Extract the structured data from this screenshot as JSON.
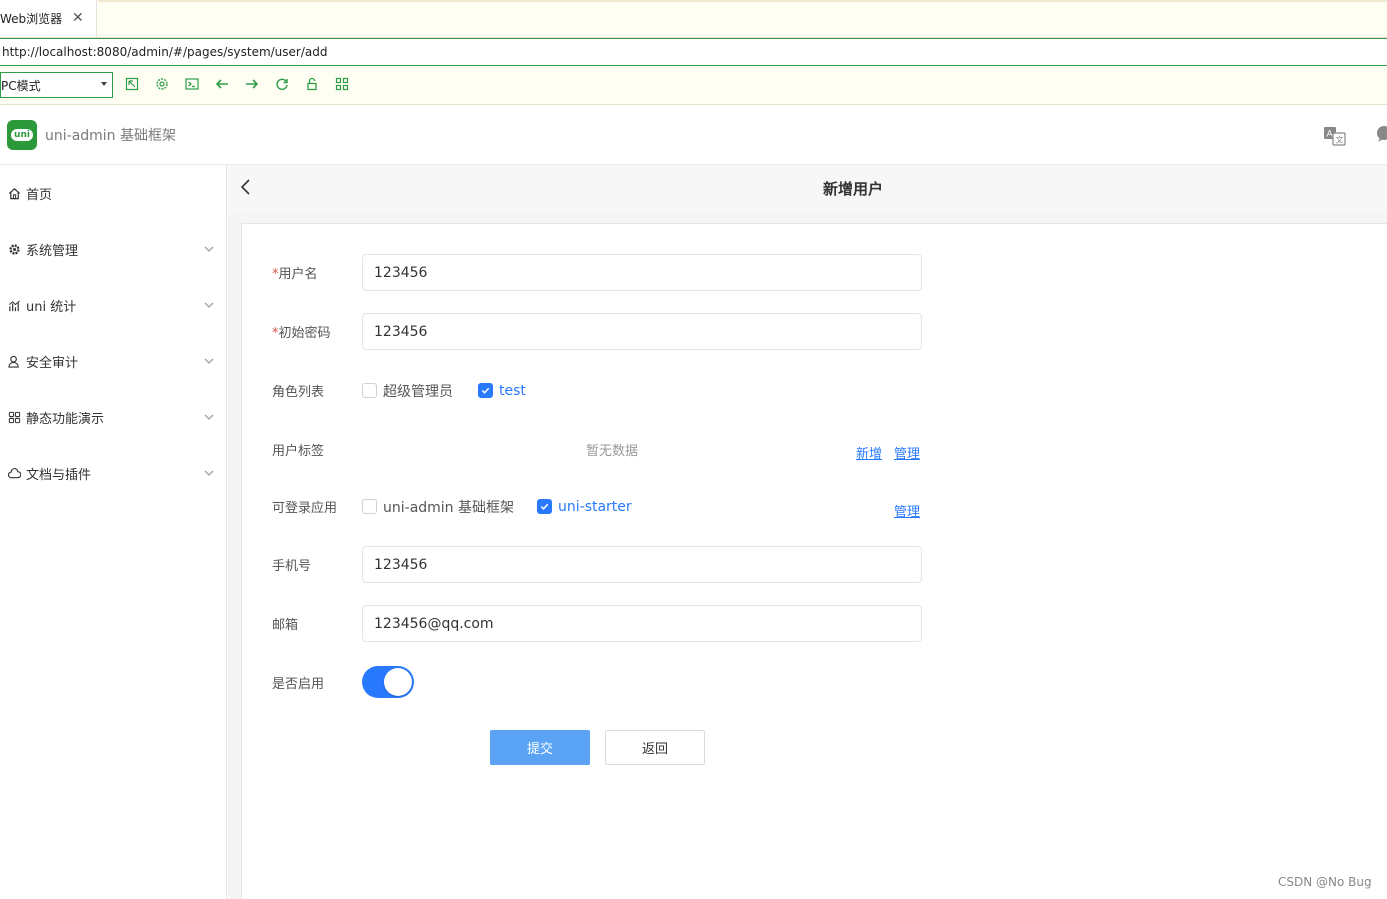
{
  "browser": {
    "tab_title": "Web浏览器",
    "tab_close": "✕",
    "url": "http://localhost:8080/admin/#/pages/system/user/add",
    "mode_select": "PC模式",
    "toolbar_icons": [
      "open-external-icon",
      "settings-icon",
      "console-icon",
      "back-arrow-icon",
      "forward-arrow-icon",
      "refresh-icon",
      "lock-icon",
      "qr-icon"
    ]
  },
  "header": {
    "logo_text": "uni",
    "app_title": "uni-admin 基础框架"
  },
  "sidebar": {
    "items": [
      {
        "label": "首页",
        "icon": "home-icon",
        "expandable": false
      },
      {
        "label": "系统管理",
        "icon": "gear-icon",
        "expandable": true
      },
      {
        "label": "uni 统计",
        "icon": "stats-icon",
        "expandable": true
      },
      {
        "label": "安全审计",
        "icon": "user-icon",
        "expandable": true
      },
      {
        "label": "静态功能演示",
        "icon": "grid-icon",
        "expandable": true
      },
      {
        "label": "文档与插件",
        "icon": "cloud-icon",
        "expandable": true
      }
    ]
  },
  "page": {
    "title": "新增用户"
  },
  "form": {
    "required_mark": "*",
    "username": {
      "label": "用户名",
      "value": "123456"
    },
    "password": {
      "label": "初始密码",
      "value": "123456"
    },
    "roles": {
      "label": "角色列表",
      "options": [
        {
          "label": "超级管理员",
          "checked": false
        },
        {
          "label": "test",
          "checked": true
        }
      ]
    },
    "tags": {
      "label": "用户标签",
      "empty": "暂无数据",
      "add_link": "新增",
      "manage_link": "管理"
    },
    "apps": {
      "label": "可登录应用",
      "options": [
        {
          "label": "uni-admin 基础框架",
          "checked": false
        },
        {
          "label": "uni-starter",
          "checked": true
        }
      ],
      "manage_link": "管理"
    },
    "mobile": {
      "label": "手机号",
      "value": "123456"
    },
    "email": {
      "label": "邮箱",
      "value": "123456@qq.com"
    },
    "enabled": {
      "label": "是否启用",
      "value": true
    },
    "submit": "提交",
    "back": "返回"
  },
  "watermark": "CSDN @No  Bug",
  "colors": {
    "primary": "#2979ff",
    "primary_button": "#5ba4f5",
    "required": "#dd524d",
    "logo_green": "#2b9939",
    "browser_accent": "#2e9d49"
  }
}
